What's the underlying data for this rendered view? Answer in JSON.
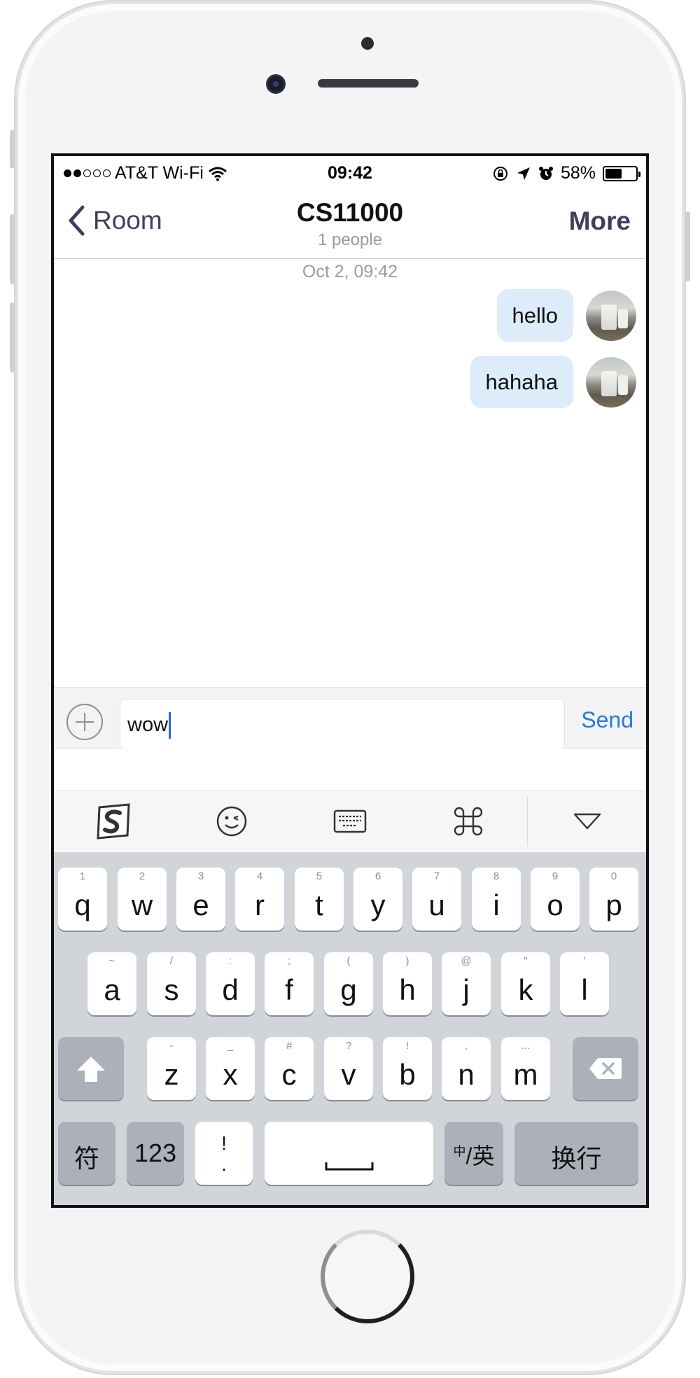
{
  "status_bar": {
    "carrier": "AT&T Wi-Fi",
    "time": "09:42",
    "battery": "58%",
    "battery_level": 0.58
  },
  "nav": {
    "back_label": "Room",
    "title": "CS11000",
    "subtitle": "1 people",
    "more_label": "More"
  },
  "chat": {
    "timestamp": "Oct 2, 09:42",
    "messages": [
      {
        "text": "hello"
      },
      {
        "text": "hahaha"
      }
    ]
  },
  "composer": {
    "value": "wow",
    "send_label": "Send"
  },
  "keyboard": {
    "row1": [
      {
        "hint": "1",
        "key": "q"
      },
      {
        "hint": "2",
        "key": "w"
      },
      {
        "hint": "3",
        "key": "e"
      },
      {
        "hint": "4",
        "key": "r"
      },
      {
        "hint": "5",
        "key": "t"
      },
      {
        "hint": "6",
        "key": "y"
      },
      {
        "hint": "7",
        "key": "u"
      },
      {
        "hint": "8",
        "key": "i"
      },
      {
        "hint": "9",
        "key": "o"
      },
      {
        "hint": "0",
        "key": "p"
      }
    ],
    "row2": [
      {
        "hint": "~",
        "key": "a"
      },
      {
        "hint": "/",
        "key": "s"
      },
      {
        "hint": ":",
        "key": "d"
      },
      {
        "hint": ";",
        "key": "f"
      },
      {
        "hint": "(",
        "key": "g"
      },
      {
        "hint": ")",
        "key": "h"
      },
      {
        "hint": "@",
        "key": "j"
      },
      {
        "hint": "\"",
        "key": "k"
      },
      {
        "hint": "'",
        "key": "l"
      }
    ],
    "row3": [
      {
        "hint": "-",
        "key": "z"
      },
      {
        "hint": "_",
        "key": "x"
      },
      {
        "hint": "#",
        "key": "c"
      },
      {
        "hint": "?",
        "key": "v"
      },
      {
        "hint": "!",
        "key": "b"
      },
      {
        "hint": ",",
        "key": "n"
      },
      {
        "hint": "...",
        "key": "m"
      }
    ],
    "symbols_label": "符",
    "numbers_label": "123",
    "punct_hint": "!",
    "punct_label": ".",
    "lang_toggle_small": "中",
    "lang_toggle_label": "/英",
    "return_label": "换行"
  }
}
